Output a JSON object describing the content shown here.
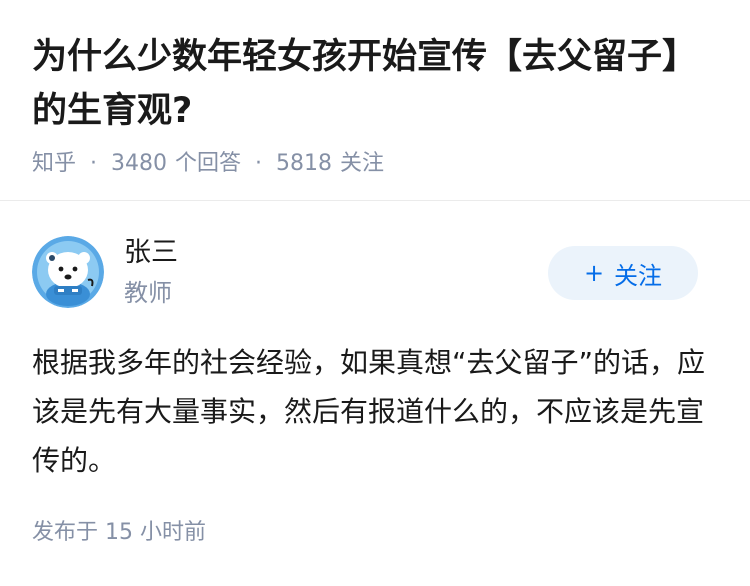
{
  "question": {
    "title": "为什么少数年轻女孩开始宣传【去父留子】的生育观?",
    "source": "知乎",
    "answer_count": "3480",
    "answer_label": "个回答",
    "follow_count": "5818",
    "follow_label": "关注"
  },
  "answer": {
    "author": {
      "name": "张三",
      "title": "教师",
      "avatar_icon": "polar-bear-avatar"
    },
    "follow_button": {
      "plus": "+",
      "label": "关注",
      "color": "#056de8",
      "background": "#ebf3fb"
    },
    "content": "根据我多年的社会经验，如果真想“去父留子”的话，应该是先有大量事实，然后有报道什么的，不应该是先宣传的。",
    "posted": "发布于 15 小时前"
  },
  "colors": {
    "text": "#1a1a1a",
    "meta": "#8590a6",
    "accent": "#056de8"
  }
}
